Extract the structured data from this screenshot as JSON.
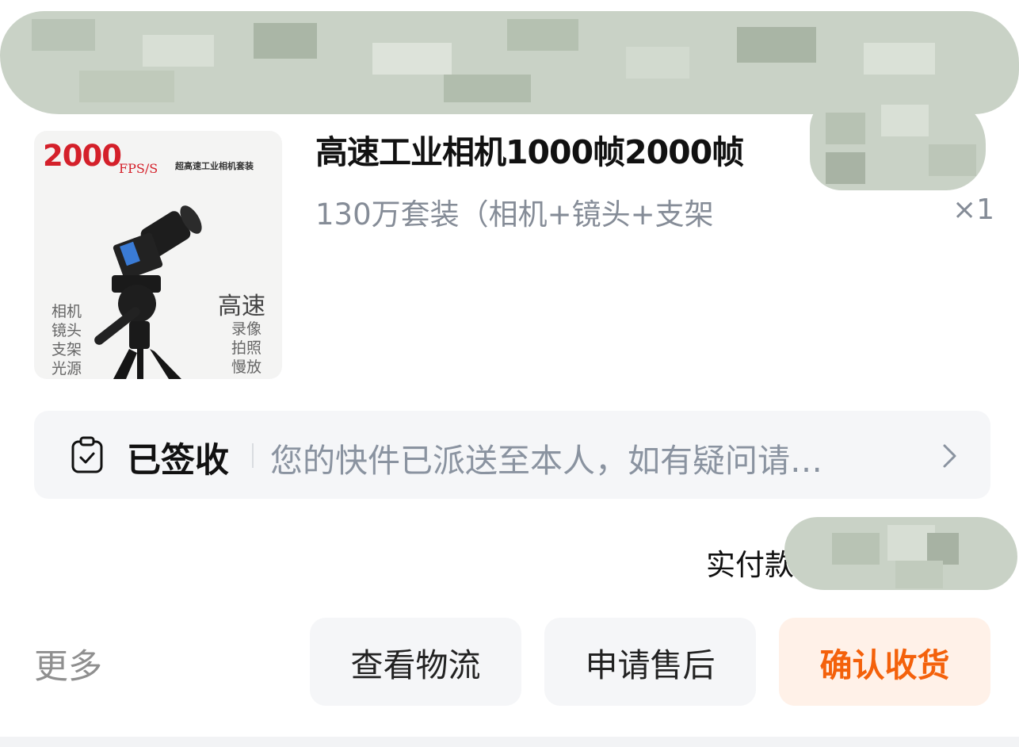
{
  "product": {
    "title": "高速工业相机1000帧2000帧",
    "spec": "130万套装（相机+镜头+支架",
    "quantity": "×1",
    "thumbnail": {
      "fps_number": "2000",
      "fps_unit": "FPS/S",
      "kit_label": "超高速工业相机套装",
      "left_lines": [
        "相机",
        "镜头",
        "支架",
        "光源"
      ],
      "headline": "高速",
      "right_lines": [
        "录像",
        "拍照",
        "慢放"
      ]
    }
  },
  "logistics": {
    "status": "已签收",
    "message": "您的快件已派送至本人，如有疑问请…",
    "icon": "clipboard-check-icon"
  },
  "payment": {
    "label": "实付款"
  },
  "actions": {
    "more": "更多",
    "view_logistics": "查看物流",
    "after_sales": "申请售后",
    "confirm_receipt": "确认收货"
  },
  "colors": {
    "accent": "#f4610b",
    "accent_bg": "#fff1e8",
    "muted_text": "#858c97"
  }
}
